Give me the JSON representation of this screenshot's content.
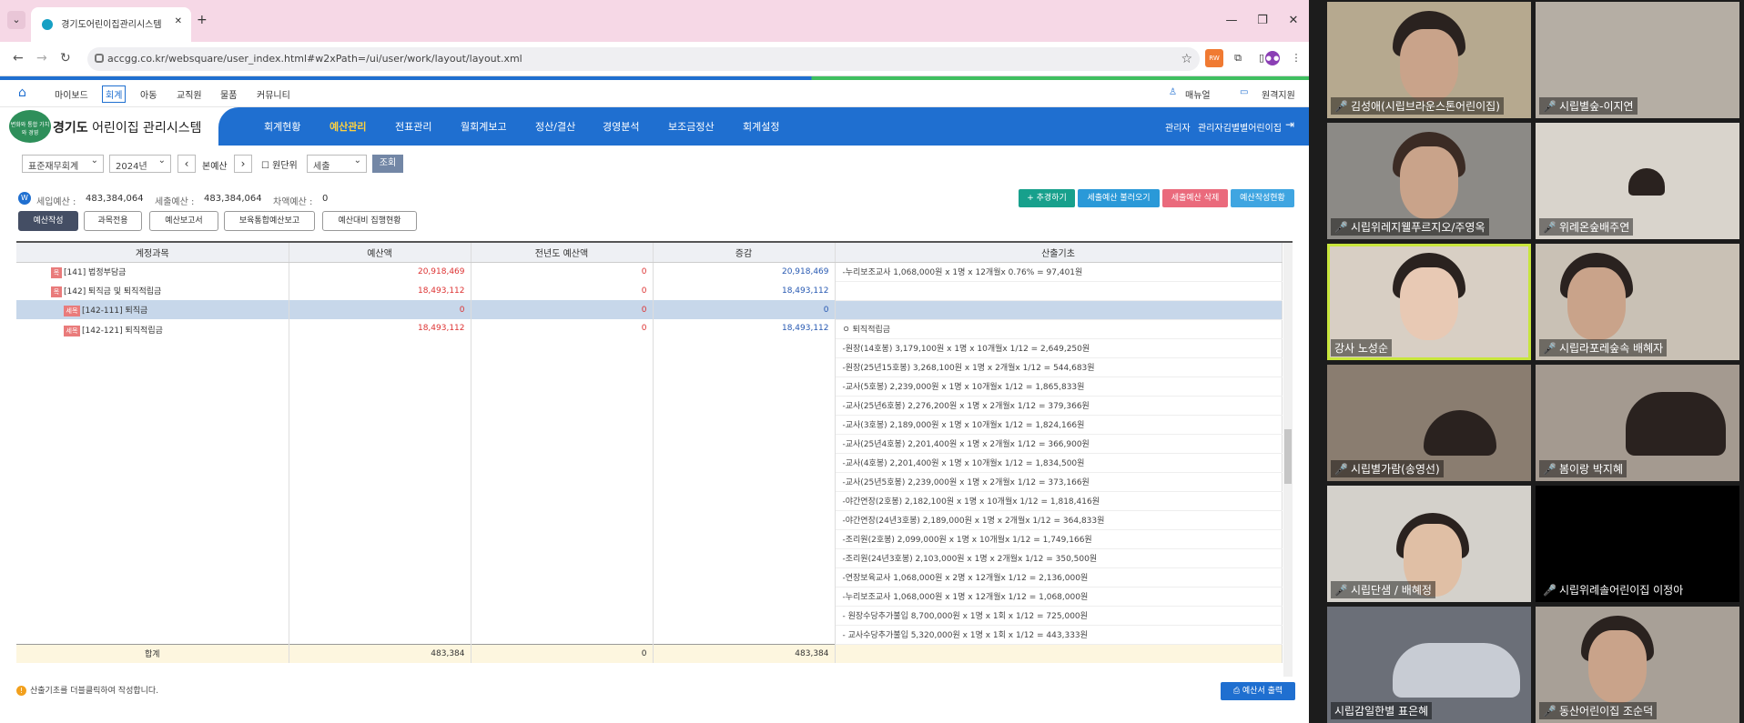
{
  "browser": {
    "tab_title": "경기도어린이집관리시스템",
    "url": "accgg.co.kr/websquare/user_index.html#w2xPath=/ui/user/work/layout/layout.xml"
  },
  "topmenu": {
    "items": [
      "마이보드",
      "회계",
      "아동",
      "교직원",
      "물품",
      "커뮤니티"
    ],
    "active": "회계",
    "right": [
      "매뉴얼",
      "원격지원"
    ]
  },
  "header": {
    "logo_text": "변화와 통합 가치와 경영",
    "title_bold": "경기도",
    "title_rest": " 어린이집 관리시스템",
    "nav": [
      "회계현황",
      "예산관리",
      "전표관리",
      "월회계보고",
      "정산/결산",
      "경영분석",
      "보조금정산",
      "회계설정"
    ],
    "nav_active": "예산관리",
    "user": "관리자",
    "org": "관리자김별별어린이집"
  },
  "filters": {
    "accounting": "표준재무회계",
    "year": "2024년",
    "budget_type": "본예산",
    "unit_checkbox": "원단위",
    "category": "세출",
    "query_button": "조회"
  },
  "summary": {
    "revenue_label": "세입예산 :",
    "revenue_value": "483,384,064",
    "expense_label": "세출예산 :",
    "expense_value": "483,384,064",
    "diff_label": "차액예산 :",
    "diff_value": "0",
    "buttons": [
      "+ 추경하기",
      "세출예산 불러오기",
      "세출예산 삭제",
      "예산작성현황"
    ]
  },
  "tabs": [
    "예산작성",
    "과목전용",
    "예산보고서",
    "보육통합예산보고",
    "예산대비 집행현황"
  ],
  "tabs_active": "예산작성",
  "table": {
    "headers": [
      "계정과목",
      "예산액",
      "전년도 예산액",
      "증감",
      "산출기초"
    ],
    "rows": [
      {
        "badge": "목",
        "account": "[141] 법정부담금",
        "budget": "20,918,469",
        "prev": "0",
        "diff": "20,918,469",
        "basis": "-누리보조교사 1,068,000원 x 1명 x 12개월x 0.76% = 97,401원"
      },
      {
        "badge": "목",
        "account": "[142] 퇴직금 및 퇴직적립금",
        "budget": "18,493,112",
        "prev": "0",
        "diff": "18,493,112",
        "basis": ""
      },
      {
        "badge": "세목",
        "account": "[142-111] 퇴직금",
        "budget": "0",
        "prev": "0",
        "diff": "0",
        "basis": ""
      },
      {
        "badge": "세목",
        "account": "[142-121] 퇴직적립금",
        "budget": "18,493,112",
        "prev": "0",
        "diff": "18,493,112",
        "basis": "ㅇ 퇴직적립금"
      }
    ],
    "basis_lines": [
      "-원장(14호봉) 3,179,100원 x 1명 x 10개월x 1/12 = 2,649,250원",
      "-원장(25년15호봉) 3,268,100원 x 1명 x 2개월x 1/12 = 544,683원",
      "-교사(5호봉) 2,239,000원 x 1명 x 10개월x 1/12 = 1,865,833원",
      "-교사(25년6호봉) 2,276,200원 x 1명 x 2개월x 1/12 = 379,366원",
      "-교사(3호봉) 2,189,000원 x 1명 x 10개월x 1/12 = 1,824,166원",
      "-교사(25년4호봉) 2,201,400원 x 1명 x 2개월x 1/12 = 366,900원",
      "-교사(4호봉) 2,201,400원 x 1명 x 10개월x 1/12 = 1,834,500원",
      "-교사(25년5호봉) 2,239,000원 x 1명 x 2개월x 1/12 = 373,166원",
      "-야간연장(2호봉) 2,182,100원 x 1명 x 10개월x 1/12 = 1,818,416원",
      "-야간연장(24년3호봉) 2,189,000원 x 1명 x 2개월x 1/12 = 364,833원",
      "-조리원(2호봉) 2,099,000원 x 1명 x 10개월x 1/12 = 1,749,166원",
      "-조리원(24년3호봉) 2,103,000원 x 1명 x 2개월x 1/12 = 350,500원",
      "-연장보육교사 1,068,000원 x 2명 x 12개월x 1/12 = 2,136,000원",
      "-누리보조교사 1,068,000원 x 1명 x 12개월x 1/12 = 1,068,000원",
      "- 원장수당추가불입 8,700,000원 x 1명 x 1회 x 1/12 = 725,000원",
      "- 교사수당추가불입 5,320,000원 x 1명 x 1회 x 1/12 = 443,333원"
    ],
    "total": {
      "label": "합계",
      "budget": "483,384",
      "prev": "0",
      "diff": "483,384"
    }
  },
  "footer": {
    "hint": "산출기초를 더블클릭하여 작성합니다.",
    "print_button": "예산서 출력"
  },
  "participants": [
    "김성애(시립브라운스톤어린이집)",
    "시립별숲-이지연",
    "시립위레지웰푸르지오/주영옥",
    "위례온숲배주연",
    "강사 노성순",
    "시립라포레숲속 배혜자",
    "시립별가람(송영선)",
    "봄이랑 박지혜",
    "시립단샘 / 배혜정",
    "시립위례솔어린이집 이정아",
    "시립감일한별 표은혜",
    "동산어린이집 조순덕"
  ],
  "colors": {
    "primary": "#1f6fd0",
    "nav_active": "#ffd23f",
    "red": "#d33333",
    "blue": "#2759b2",
    "speaker_highlight": "#c8e63c"
  }
}
